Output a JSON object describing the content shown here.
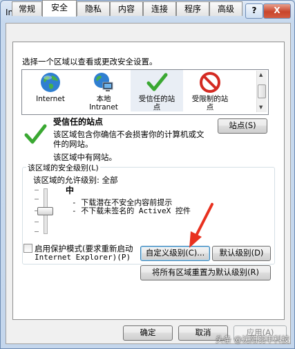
{
  "window": {
    "title": "Internet 选项",
    "help_btn": "?",
    "close_btn": "X"
  },
  "tabs": [
    "常规",
    "安全",
    "隐私",
    "内容",
    "连接",
    "程序",
    "高级"
  ],
  "active_tab": "安全",
  "security": {
    "instruction": "选择一个区域以查看或更改安全设置。",
    "zones": [
      {
        "label1": "Internet",
        "label2": "",
        "icon": "globe-icon"
      },
      {
        "label1": "本地",
        "label2": "Intranet",
        "icon": "intranet-icon"
      },
      {
        "label1": "受信任的站",
        "label2": "点",
        "icon": "checkmark-icon"
      },
      {
        "label1": "受限制的站",
        "label2": "点",
        "icon": "restricted-icon"
      }
    ],
    "selected_zone": {
      "title": "受信任的站点",
      "desc_line1": "该区域包含你确信不会损害你的计算机或文",
      "desc_line2": "件的网站。",
      "status": "该区域中有网站。",
      "sites_button": "站点(S)"
    },
    "level_group": {
      "title": "该区域的安全级别(L)",
      "allowed_levels": "该区域的允许级别: 全部",
      "current_level": "中",
      "bullet1": "- 下载潜在不安全内容前提示",
      "bullet2": "- 不下载未签名的 ActiveX 控件"
    },
    "protected_mode": {
      "line1": "启用保护模式(要求重新启动",
      "line2": "Internet Explorer)(P)"
    },
    "custom_level_button": "自定义级别(C)...",
    "default_level_button": "默认级别(D)",
    "reset_all_button": "将所有区域重置为默认级别(R)"
  },
  "footer": {
    "ok": "确定",
    "cancel": "取消",
    "apply": "应用(A)"
  },
  "watermark": "头条 @沈阳羽丰科技",
  "colors": {
    "titlebar": "#c9dbee",
    "close": "#c8452c",
    "arrow": "#e8311f",
    "trusted_check": "#3aa832",
    "restricted": "#d42a22"
  }
}
